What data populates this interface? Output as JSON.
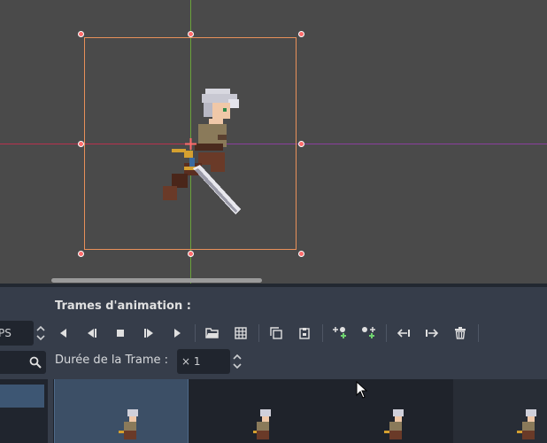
{
  "panel": {
    "title": "Trames d'animation :",
    "fps_value": "PS",
    "duration_label": "Durée de la Trame :",
    "duration_value": "× 1"
  },
  "toolbar": {
    "buttons": [
      {
        "name": "play-backwards-button",
        "icon": "triangle-left-icon"
      },
      {
        "name": "play-backwards-from-end-button",
        "icon": "skip-back-icon"
      },
      {
        "name": "stop-button",
        "icon": "stop-square-icon"
      },
      {
        "name": "play-from-start-button",
        "icon": "skip-forward-icon"
      },
      {
        "name": "play-button",
        "icon": "triangle-right-icon"
      },
      {
        "name": "load-frames-button",
        "icon": "folder-open-icon"
      },
      {
        "name": "load-spritesheet-button",
        "icon": "grid-icon"
      },
      {
        "name": "copy-frame-button",
        "icon": "copy-icon"
      },
      {
        "name": "paste-frame-button",
        "icon": "paste-icon"
      },
      {
        "name": "insert-before-button",
        "icon": "insert-before-icon"
      },
      {
        "name": "insert-after-button",
        "icon": "insert-after-icon"
      },
      {
        "name": "move-left-button",
        "icon": "arrow-left-icon"
      },
      {
        "name": "move-right-button",
        "icon": "arrow-right-icon"
      },
      {
        "name": "delete-frame-button",
        "icon": "trash-icon"
      }
    ]
  },
  "frames": {
    "count_visible": 4,
    "selected_index": 0
  },
  "colors": {
    "viewport_bg": "#4a4a4a",
    "panel_bg": "#363d4a",
    "selection_rect": "#e8905a",
    "handle": "#ff6b6b",
    "axis_x": "#b8324e",
    "axis_y": "#6aa33a",
    "accent": "#3c4f66"
  }
}
